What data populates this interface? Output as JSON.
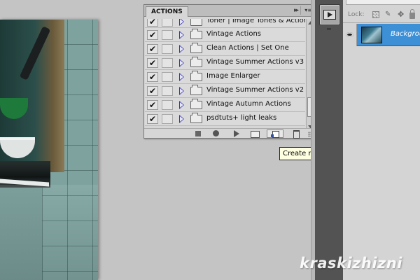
{
  "actions_panel": {
    "tab_label": "ACTIONS",
    "collapse_glyph": "▸▸",
    "menu_glyph": "▾≡",
    "items": [
      {
        "label": "Toner | Image Tones & Actions",
        "checked": true
      },
      {
        "label": "Vintage Actions",
        "checked": true
      },
      {
        "label": "Clean Actions | Set One",
        "checked": true
      },
      {
        "label": "Vintage Summer Actions v3",
        "checked": true
      },
      {
        "label": "Image Enlarger",
        "checked": true
      },
      {
        "label": "Vintage Summer Actions v2",
        "checked": true
      },
      {
        "label": "Vintage Autumn Actions",
        "checked": true
      },
      {
        "label": "psdtuts+ light leaks",
        "checked": true
      }
    ],
    "checkmark": "✔",
    "footer_icons": [
      "stop-icon",
      "record-icon",
      "play-icon",
      "new-set-icon",
      "new-action-icon",
      "trash-icon"
    ]
  },
  "tooltip": {
    "text": "Create new action"
  },
  "layers_panel": {
    "lock_label": "Lock:",
    "brush_glyph": "✎",
    "move_glyph": "✥",
    "layer_name": "Background",
    "selected_color": "#3d8fd6"
  },
  "watermark": {
    "text": "kraskizhizni"
  }
}
